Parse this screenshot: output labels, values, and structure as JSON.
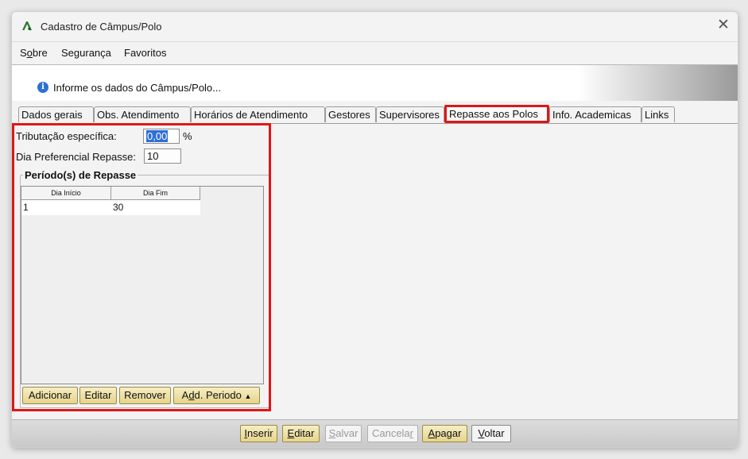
{
  "window": {
    "title": "Cadastro de Câmpus/Polo",
    "close_glyph": "✕",
    "app_icon": "app-logo-icon"
  },
  "menu": [
    {
      "pre": "S",
      "ul": "o",
      "post": "bre"
    },
    {
      "pre": "Segurança",
      "ul": "",
      "post": ""
    },
    {
      "pre": "Favoritos",
      "ul": "",
      "post": ""
    }
  ],
  "info": {
    "icon": "info-icon",
    "glyph": "i",
    "text": "Informe os dados do Câmpus/Polo..."
  },
  "tabs": [
    {
      "label": "Dados gerais",
      "active": false
    },
    {
      "label": "Obs. Atendimento",
      "active": false
    },
    {
      "label": "Horários de Atendimento",
      "active": false
    },
    {
      "label": "Gestores",
      "active": false
    },
    {
      "label": "Supervisores",
      "active": false
    },
    {
      "label": "Repasse aos Polos",
      "active": true
    },
    {
      "label": "Info. Academicas",
      "active": false
    },
    {
      "label": "Links",
      "active": false
    }
  ],
  "form": {
    "tributacao_label": "Tributação específica:",
    "tributacao_value": "0,00",
    "tributacao_unit": "%",
    "dia_pref_label": "Dia Preferencial Repasse:",
    "dia_pref_value": "10",
    "periodos_title": "Período(s) de Repasse"
  },
  "periodos_table": {
    "columns": [
      "Dia Início",
      "Dia Fim"
    ],
    "rows": [
      [
        "1",
        "30"
      ]
    ]
  },
  "periodo_buttons": {
    "adicionar": "Adicionar",
    "editar": "Editar",
    "remover": "Remover",
    "add_periodo_pre": "A",
    "add_periodo_ul": "d",
    "add_periodo_post": "d. Periodo",
    "add_periodo_arrow": "▲"
  },
  "bottom_buttons": {
    "inserir": {
      "pre": "",
      "ul": "I",
      "post": "nserir",
      "enabled": true
    },
    "editar": {
      "pre": "",
      "ul": "E",
      "post": "ditar",
      "enabled": true
    },
    "salvar": {
      "pre": "",
      "ul": "S",
      "post": "alvar",
      "enabled": false
    },
    "cancelar": {
      "pre": "Cancela",
      "ul": "r",
      "post": "",
      "enabled": false
    },
    "apagar": {
      "pre": "",
      "ul": "A",
      "post": "pagar",
      "enabled": true
    },
    "voltar": {
      "pre": "",
      "ul": "V",
      "post": "oltar",
      "enabled": true
    }
  }
}
